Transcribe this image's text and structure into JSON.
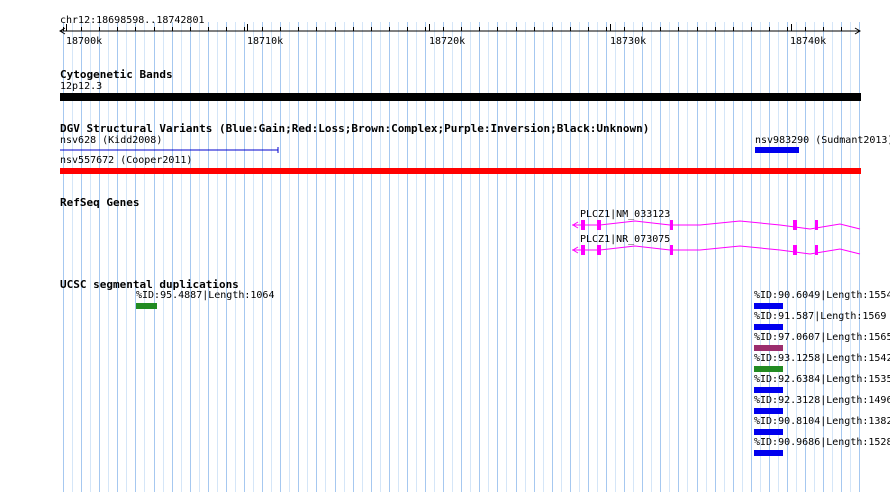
{
  "ruler": {
    "location": "chr12:18698598..18742801",
    "ticks": [
      "18700k",
      "18710k",
      "18720k",
      "18730k",
      "18740k"
    ]
  },
  "tracks": {
    "cytoband": {
      "title": "Cytogenetic Bands",
      "band_label": "12p12.3",
      "band_color": "#000000"
    },
    "dgv": {
      "title": "DGV Structural Variants (Blue:Gain;Red:Loss;Brown:Complex;Purple:Inversion;Black:Unknown)",
      "features": [
        {
          "label": "nsv628 (Kidd2008)",
          "color": "#0000cc",
          "style": "line"
        },
        {
          "label": "nsv983290 (Sudmant2013)",
          "color": "#0000ee",
          "style": "box"
        },
        {
          "label": "nsv557672 (Cooper2011)",
          "color": "#ff0000",
          "style": "box"
        }
      ]
    },
    "refseq": {
      "title": "RefSeq Genes",
      "features": [
        {
          "label": "PLCZ1|NM_033123",
          "color": "#ff00ff"
        },
        {
          "label": "PLCZ1|NR_073075",
          "color": "#ff00ff"
        }
      ]
    },
    "segdups": {
      "title": "UCSC segmental duplications",
      "features": [
        {
          "label": "%ID:95.4887|Length:1064",
          "color": "#228b22"
        },
        {
          "label": "%ID:90.6049|Length:1554",
          "color": "#0000ee"
        },
        {
          "label": "%ID:91.587|Length:1569",
          "color": "#0000ee"
        },
        {
          "label": "%ID:97.0607|Length:1565",
          "color": "#9b2d6e"
        },
        {
          "label": "%ID:93.1258|Length:1542",
          "color": "#228b22"
        },
        {
          "label": "%ID:92.6384|Length:1535",
          "color": "#0000ee"
        },
        {
          "label": "%ID:92.3128|Length:1496",
          "color": "#0000ee"
        },
        {
          "label": "%ID:90.8104|Length:1382",
          "color": "#0000ee"
        },
        {
          "label": "%ID:90.9686|Length:1528",
          "color": "#0000ee"
        }
      ]
    }
  },
  "grid": {
    "major_color": "#a6c8f0",
    "minor_color": "#d5e6f8"
  }
}
